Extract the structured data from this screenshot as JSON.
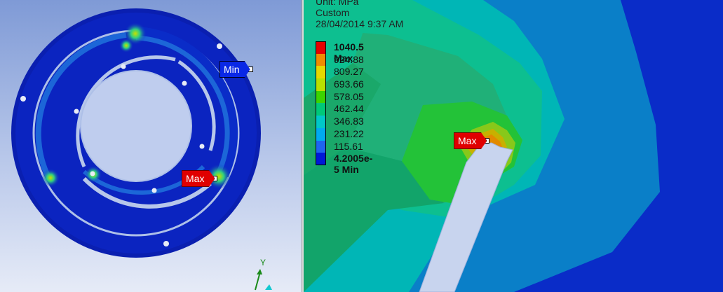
{
  "legend": {
    "unit": "Unit: MPa",
    "scale": "Custom",
    "timestamp": "28/04/2014 9:37 AM",
    "entries": [
      {
        "label": "1040.5 Max",
        "color": "#e60000",
        "bold": true
      },
      {
        "label": "924.88",
        "color": "#f08c00",
        "bold": false
      },
      {
        "label": "809.27",
        "color": "#e6d800",
        "bold": false
      },
      {
        "label": "693.66",
        "color": "#b8e000",
        "bold": false
      },
      {
        "label": "578.05",
        "color": "#3cd400",
        "bold": false
      },
      {
        "label": "462.44",
        "color": "#00c878",
        "bold": false
      },
      {
        "label": "346.83",
        "color": "#00c8c8",
        "bold": false
      },
      {
        "label": "231.22",
        "color": "#00aaf0",
        "bold": false
      },
      {
        "label": "115.61",
        "color": "#1e64f0",
        "bold": false
      },
      {
        "label": "4.2005e-5 Min",
        "color": "#0018d8",
        "bold": true
      }
    ]
  },
  "probes": {
    "max_label": "Max",
    "min_label": "Min"
  },
  "triad": {
    "y_label": "Y"
  }
}
